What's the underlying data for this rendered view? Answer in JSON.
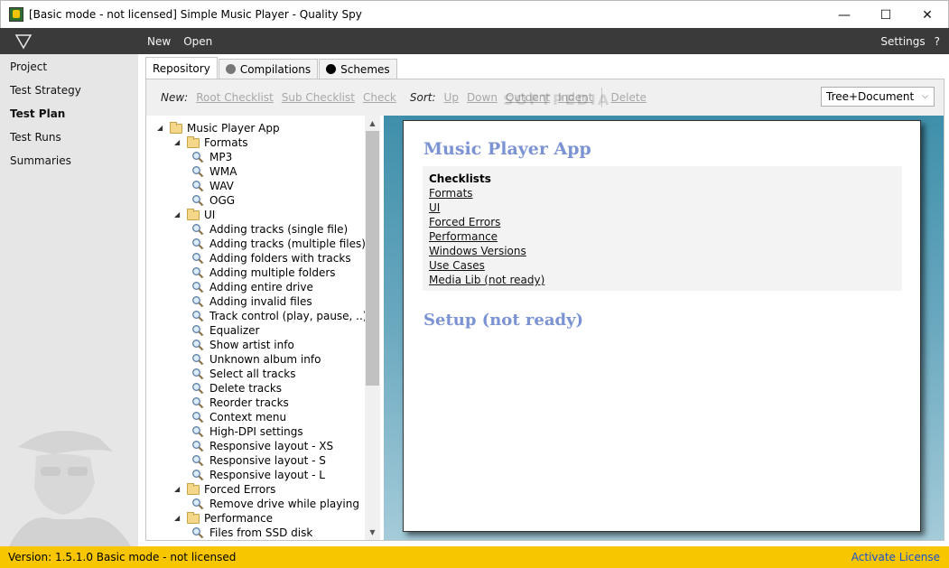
{
  "window": {
    "title": "[Basic mode - not licensed] Simple Music Player - Quality Spy",
    "minimize": "—",
    "maximize": "☐",
    "close": "✕"
  },
  "menubar": {
    "items": [
      "New",
      "Open"
    ],
    "settings": "Settings",
    "help": "?"
  },
  "sidebar": {
    "items": [
      "Project",
      "Test Strategy",
      "Test Plan",
      "Test Runs",
      "Summaries"
    ],
    "active": "Test Plan"
  },
  "tabs": [
    {
      "label": "Repository",
      "icon": "",
      "active": true
    },
    {
      "label": "Compilations",
      "icon": "gray-circle-icon",
      "color": "#777777"
    },
    {
      "label": "Schemes",
      "icon": "black-circle-icon",
      "color": "#000000"
    }
  ],
  "toolbar": {
    "new_label": "New:",
    "new_actions": [
      "Root Checklist",
      "Sub Checklist",
      "Check"
    ],
    "sort_label": "Sort:",
    "sort_actions": [
      "Up",
      "Down",
      "Outdent",
      "Indent"
    ],
    "delete": "Delete",
    "view_select": "Tree+Document",
    "watermark": "SOFTPEDIA"
  },
  "tree": [
    {
      "label": "Music Player App",
      "type": "folder",
      "level": 0,
      "expanded": true
    },
    {
      "label": "Formats",
      "type": "folder",
      "level": 1,
      "expanded": true
    },
    {
      "label": "MP3",
      "type": "check",
      "level": 2
    },
    {
      "label": "WMA",
      "type": "check",
      "level": 2
    },
    {
      "label": "WAV",
      "type": "check",
      "level": 2
    },
    {
      "label": "OGG",
      "type": "check",
      "level": 2
    },
    {
      "label": "UI",
      "type": "folder",
      "level": 1,
      "expanded": true
    },
    {
      "label": "Adding tracks (single file)",
      "type": "check",
      "level": 2
    },
    {
      "label": "Adding tracks (multiple files)",
      "type": "check",
      "level": 2
    },
    {
      "label": "Adding folders with tracks",
      "type": "check",
      "level": 2
    },
    {
      "label": "Adding multiple folders",
      "type": "check",
      "level": 2
    },
    {
      "label": "Adding entire drive",
      "type": "check",
      "level": 2
    },
    {
      "label": "Adding invalid files",
      "type": "check",
      "level": 2
    },
    {
      "label": "Track control (play, pause, ..)",
      "type": "check",
      "level": 2
    },
    {
      "label": "Equalizer",
      "type": "check",
      "level": 2
    },
    {
      "label": "Show artist info",
      "type": "check",
      "level": 2
    },
    {
      "label": "Unknown album info",
      "type": "check",
      "level": 2
    },
    {
      "label": "Select all tracks",
      "type": "check",
      "level": 2
    },
    {
      "label": "Delete tracks",
      "type": "check",
      "level": 2
    },
    {
      "label": "Reorder tracks",
      "type": "check",
      "level": 2
    },
    {
      "label": "Context menu",
      "type": "check",
      "level": 2
    },
    {
      "label": "High-DPI settings",
      "type": "check",
      "level": 2
    },
    {
      "label": "Responsive layout - XS",
      "type": "check",
      "level": 2
    },
    {
      "label": "Responsive layout - S",
      "type": "check",
      "level": 2
    },
    {
      "label": "Responsive layout - L",
      "type": "check",
      "level": 2
    },
    {
      "label": "Forced Errors",
      "type": "folder",
      "level": 1,
      "expanded": true
    },
    {
      "label": "Remove drive while playing",
      "type": "check",
      "level": 2
    },
    {
      "label": "Performance",
      "type": "folder",
      "level": 1,
      "expanded": true
    },
    {
      "label": "Files from SSD disk",
      "type": "check",
      "level": 2
    }
  ],
  "document": {
    "title": "Music Player App",
    "toc_title": "Checklists",
    "toc_links": [
      "Formats",
      "UI",
      "Forced Errors",
      "Performance",
      "Windows Versions",
      "Use Cases",
      "Media Lib (not ready)"
    ],
    "section2": "Setup (not ready)"
  },
  "statusbar": {
    "left": "Version: 1.5.1.0  Basic mode - not licensed",
    "right": "Activate License"
  }
}
